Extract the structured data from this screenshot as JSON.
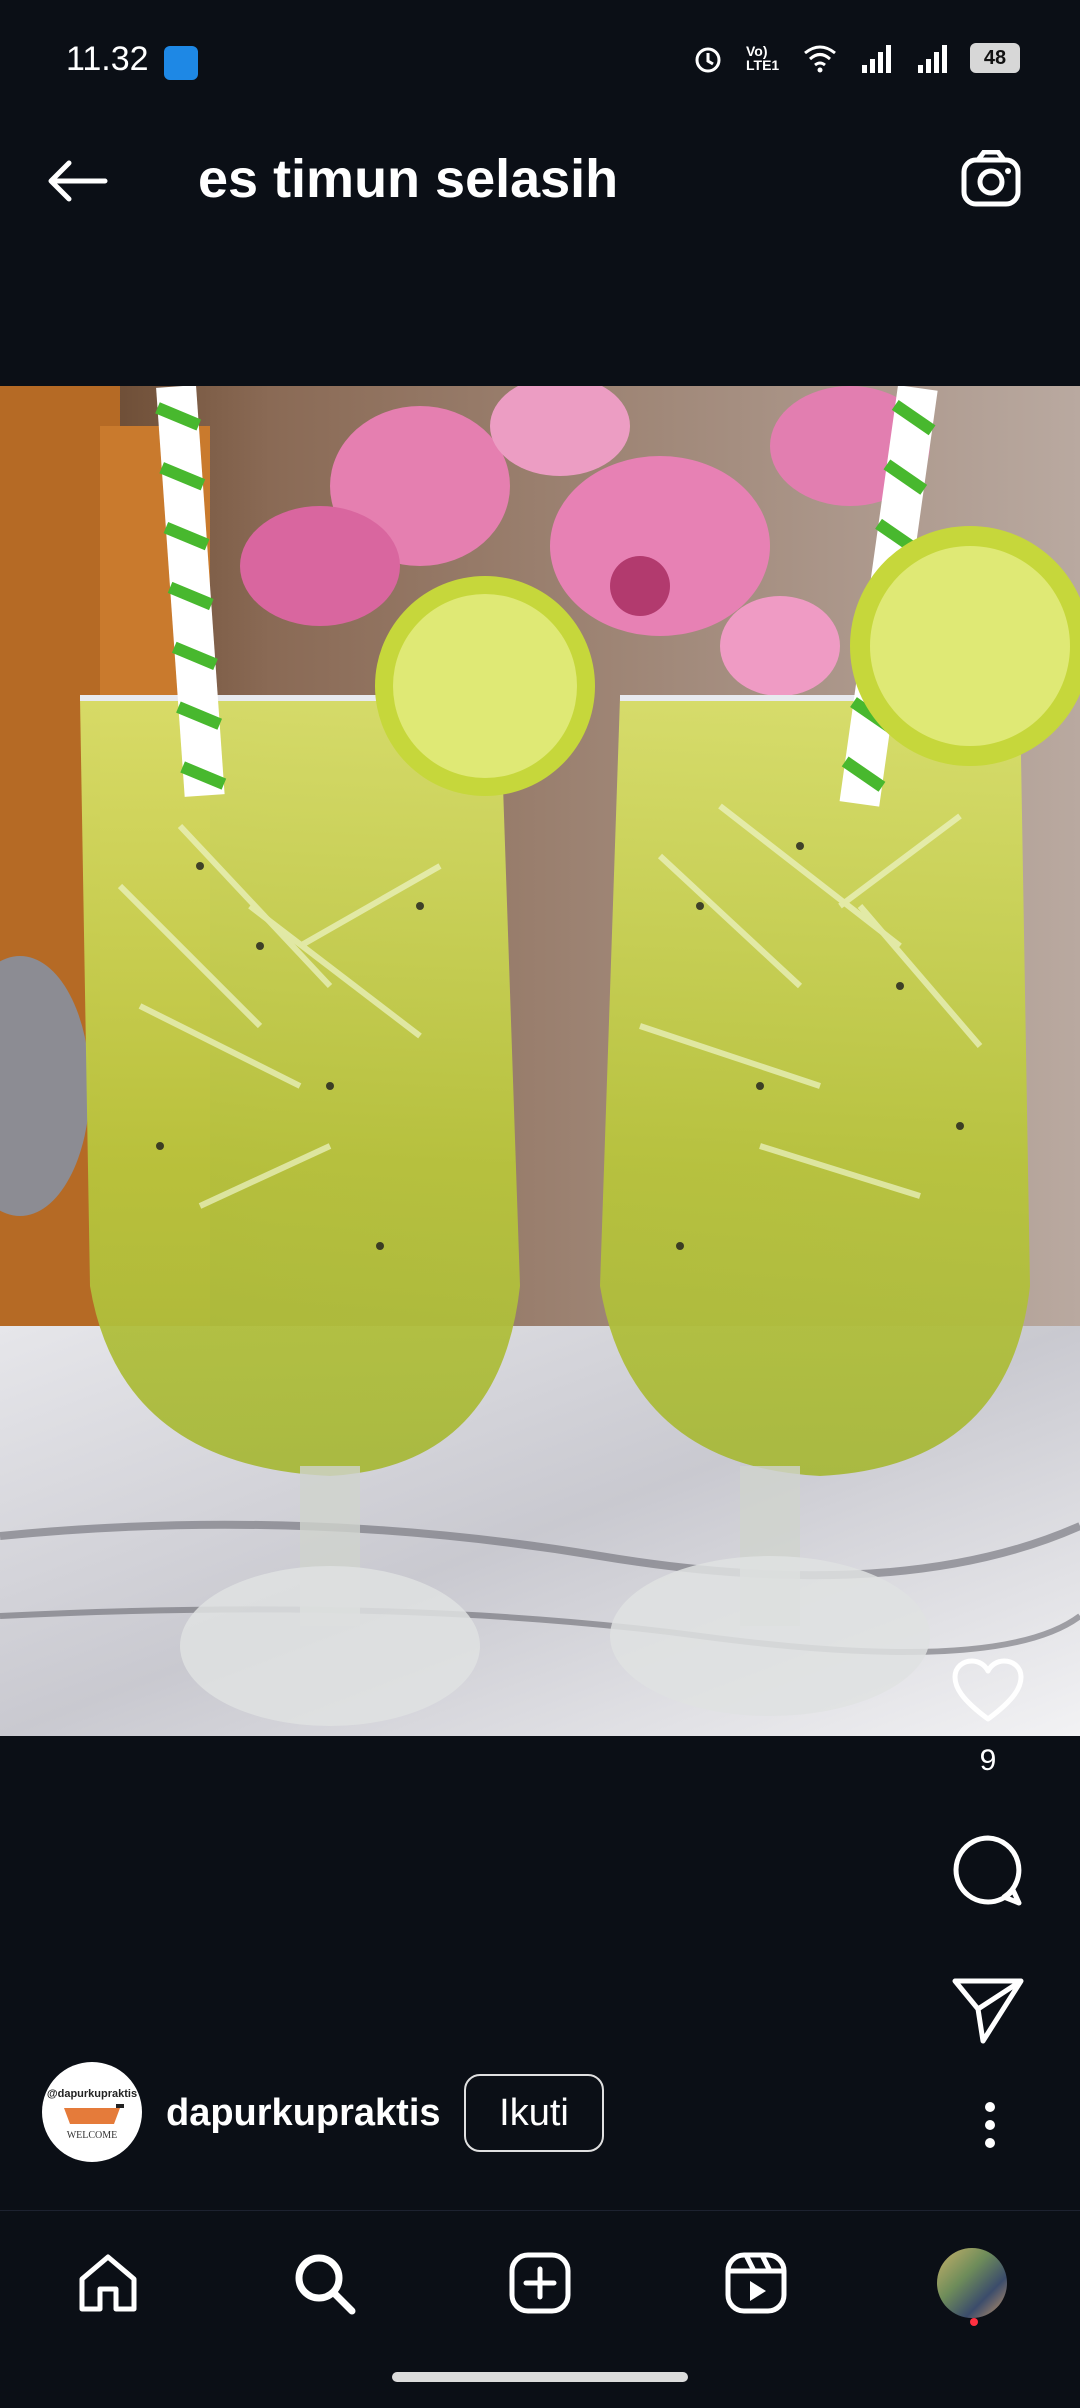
{
  "status_bar": {
    "time": "11.32",
    "network_label": "Vo) LTE1",
    "battery": "48",
    "icons": [
      "alarm-icon",
      "volte-icon",
      "wifi-icon",
      "signal-icon",
      "signal-icon",
      "battery-icon"
    ]
  },
  "header": {
    "title": "es timun selasih",
    "back_icon": "arrow-left-icon",
    "camera_icon": "camera-icon"
  },
  "post": {
    "image_description_icon": "photo",
    "likes": "9",
    "icons": [
      "heart-icon",
      "comment-icon",
      "send-icon",
      "more-vertical-icon"
    ]
  },
  "author": {
    "username": "dapurkupraktis",
    "follow_label": "Ikuti",
    "avatar_text_top": "@dapurkupraktis",
    "avatar_text_bottom": "WELCOME"
  },
  "bottom_nav": {
    "items": [
      "home-icon",
      "search-icon",
      "add-post-icon",
      "reels-icon",
      "profile-avatar"
    ]
  },
  "colors": {
    "background": "#0b0f16",
    "text": "#ffffff",
    "notification_dot": "#ff3040"
  }
}
